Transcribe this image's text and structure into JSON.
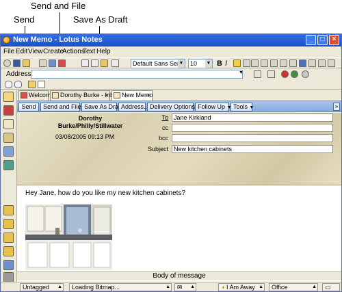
{
  "callouts": {
    "send": "Send",
    "send_and_file": "Send and File",
    "save_as_draft": "Save As Draft"
  },
  "window": {
    "title": "New Memo - Lotus Notes"
  },
  "menu": [
    "File",
    "Edit",
    "View",
    "Create",
    "Actions",
    "Text",
    "Help"
  ],
  "toolbar": {
    "font_name": "Default Sans Serif",
    "font_size": "10",
    "bold": "B",
    "italic": "I"
  },
  "address_bar": {
    "label": "Address"
  },
  "tabs": [
    {
      "label": "Welcome"
    },
    {
      "label": "Dorothy Burke - Inbox"
    },
    {
      "label": "New Memo"
    }
  ],
  "actions": {
    "send": "Send",
    "send_and_file": "Send and File...",
    "save_as_draft": "Save As Draft",
    "address": "Address...",
    "delivery_options": "Delivery Options...",
    "follow_up": "Follow Up",
    "tools": "Tools"
  },
  "memo": {
    "sender_line1": "Dorothy",
    "sender_line2": "Burke/Philly/Stillwater",
    "date": "03/08/2005 09:13 PM",
    "to_label": "To",
    "to_value": "Jane Kirkland",
    "cc_label": "cc",
    "cc_value": "",
    "bcc_label": "bcc",
    "bcc_value": "",
    "subject_label": "Subject",
    "subject_value": "New kitchen cabinets",
    "body_text": "Hey Jane, how do you like my new kitchen cabinets?"
  },
  "body_bar": "Body of message",
  "status": {
    "category": "Untagged",
    "message": "Loading Bitmap...",
    "presence": "I Am Away",
    "location": "Office"
  },
  "colors": {
    "titlebar": "#1c4fcf",
    "action_bar": "#86a9dd",
    "header_bg": "#e4dcbd"
  }
}
